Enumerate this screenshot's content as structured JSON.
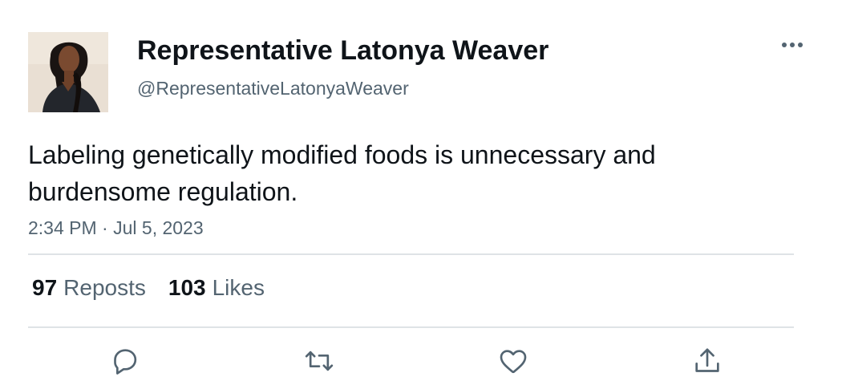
{
  "author": {
    "display_name": "Representative Latonya Weaver",
    "handle": "@RepresentativeLatonyaWeaver"
  },
  "tweet": {
    "text": "Labeling genetically modified foods is unnecessary and burdensome regulation.",
    "time": "2:34 PM",
    "separator": "·",
    "date": "Jul 5, 2023"
  },
  "stats": {
    "reposts_count": "97",
    "reposts_label": "Reposts",
    "likes_count": "103",
    "likes_label": "Likes"
  },
  "icons": {
    "more": "more-horizontal-icon",
    "reply": "reply-icon",
    "repost": "repost-icon",
    "like": "heart-icon",
    "share": "share-icon"
  },
  "colors": {
    "primary_text": "#0f1419",
    "secondary_text": "#536471",
    "icon": "#536471",
    "divider": "#dfe3e6"
  }
}
